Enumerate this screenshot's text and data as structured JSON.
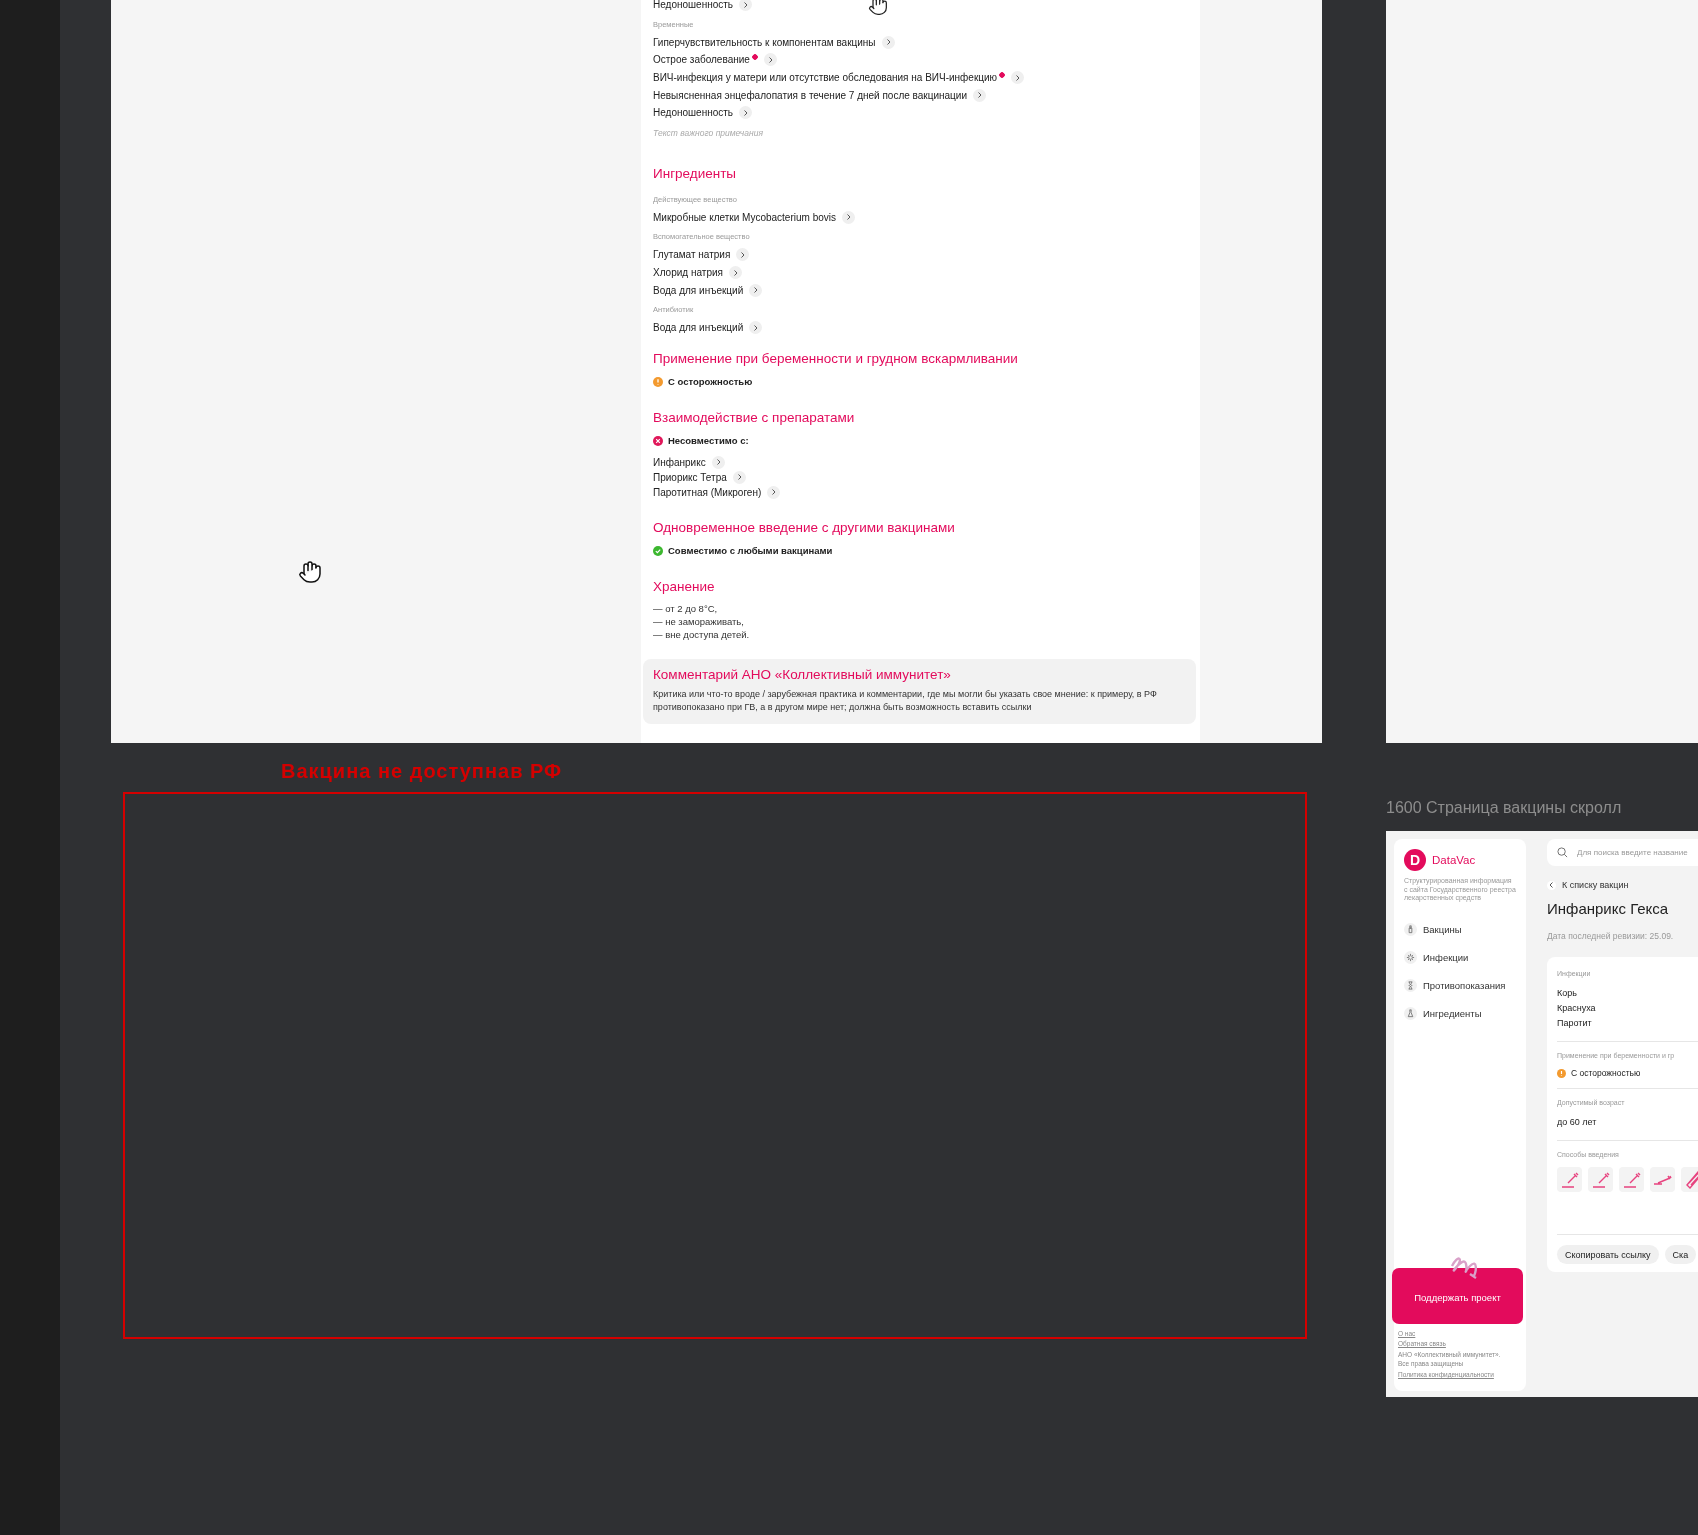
{
  "vaccine_page": {
    "blocks": [
      {
        "kind": "row",
        "text": "Недоношенность",
        "alert": false
      },
      {
        "kind": "label",
        "text": "Временные"
      },
      {
        "kind": "row",
        "text": "Гиперчувствительность к компонентам вакцины",
        "alert": false
      },
      {
        "kind": "row",
        "text": "Острое заболевание",
        "alert": true
      },
      {
        "kind": "row",
        "text": "ВИЧ-инфекция у матери или отсутствие обследования на ВИЧ-инфекцию",
        "alert": true
      },
      {
        "kind": "row",
        "text": "Невыясненная энцефалопатия в течение 7 дней после вакцинации",
        "alert": false
      },
      {
        "kind": "row",
        "text": "Недоношенность",
        "alert": false
      },
      {
        "kind": "note",
        "text": "Текст важного примечания"
      },
      {
        "kind": "heading",
        "text": "Ингредиенты"
      },
      {
        "kind": "label",
        "text": "Действующее вещество"
      },
      {
        "kind": "row",
        "text": "Микробные клетки Mycobacterium bovis",
        "alert": false
      },
      {
        "kind": "label",
        "text": "Вспомогательное вещество"
      },
      {
        "kind": "row",
        "text": "Глутамат натрия",
        "alert": false
      },
      {
        "kind": "row",
        "text": "Хлорид натрия",
        "alert": false
      },
      {
        "kind": "row",
        "text": "Вода для инъекций",
        "alert": false
      },
      {
        "kind": "label",
        "text": "Антибиотик"
      },
      {
        "kind": "row",
        "text": "Вода для инъекций",
        "alert": false
      },
      {
        "kind": "heading",
        "text": "Применение при беременности и грудном вскармливании"
      },
      {
        "kind": "caution",
        "text": "С осторожностью"
      },
      {
        "kind": "heading",
        "text": "Взаимодействие с препаратами"
      },
      {
        "kind": "incompatible",
        "text": "Несовместимо с:"
      },
      {
        "kind": "links",
        "items": [
          "Инфанрикс",
          "Приорикс Тетра",
          "Паротитная (Микроген)"
        ]
      },
      {
        "kind": "heading",
        "text": "Одновременное введение с другими вакцинами"
      },
      {
        "kind": "compatible",
        "text": "Совместимо с любыми вакцинами"
      },
      {
        "kind": "heading",
        "text": "Хранение"
      },
      {
        "kind": "lines",
        "lines": [
          "— от 2 до 8°C,",
          "— не замораживать,",
          "— вне доступа детей."
        ]
      },
      {
        "kind": "comment",
        "title": "Комментарий АНО «Коллективный иммунитет»",
        "text": "Критика или что-то вроде / зарубежная практика и комментарии, где мы могли бы указать свое мнение: к примеру, в РФ противопоказано при ГВ, а в другом мире нет; должна быть возможность вставить ссылки"
      }
    ]
  },
  "annotation": {
    "label": "Вакцина не доступнав РФ"
  },
  "preview": {
    "frame_title": "1600 Страница вакцины скролл",
    "logo_letter": "D",
    "logo_name": "DataVac",
    "tagline": "Структурированная информация с сайта Государственного реестра лекарственных средств",
    "nav": [
      {
        "kind": "vial",
        "label": "Вакцины"
      },
      {
        "kind": "virus",
        "label": "Инфекции"
      },
      {
        "kind": "hourglass",
        "label": "Противопоказания"
      },
      {
        "kind": "flask",
        "label": "Ингредиенты"
      }
    ],
    "support_button": "Поддержать проект",
    "footer_links": [
      "О нас",
      "Обратная связь"
    ],
    "copyright": "АНО «Коллективный иммунитет». Все права защищены",
    "privacy_link": "Политика конфиденциальности",
    "search": {
      "placeholder": "Для поиска введите название"
    },
    "back_link": "К списку вакцин",
    "vaccine_title": "Инфанрикс Гекса",
    "revision": "Дата последней ревизии: 25.09.",
    "card": [
      {
        "kind": "list",
        "label": "Инфекции",
        "items": [
          "Корь",
          "Краснуха",
          "Паротит"
        ]
      },
      {
        "kind": "caution",
        "label": "Применение при беременности и гр",
        "text": "С осторожностью"
      },
      {
        "kind": "value",
        "label": "Допустимый возраст",
        "text": "до 60 лет"
      },
      {
        "kind": "routes",
        "label": "Способы введения",
        "routes": [
          {
            "kind": "angled"
          },
          {
            "kind": "angled"
          },
          {
            "kind": "angled"
          },
          {
            "kind": "flat"
          },
          {
            "kind": "pen"
          }
        ]
      }
    ],
    "buttons": [
      "Скопировать ссылку",
      "Ска"
    ]
  }
}
